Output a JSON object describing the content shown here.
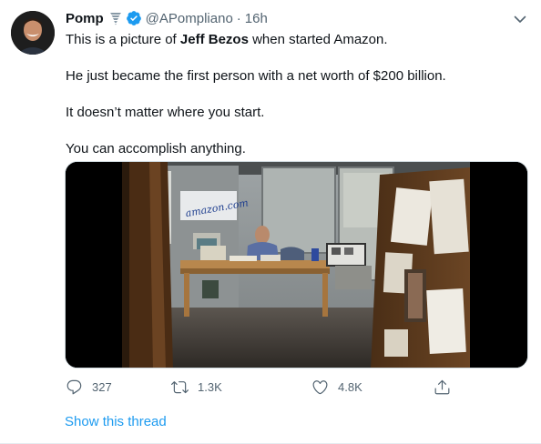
{
  "author": {
    "name": "Pomp",
    "handle": "@APompliano",
    "separator": "·",
    "time": "16h"
  },
  "tweet": {
    "line1_prefix": "This is a picture of ",
    "line1_bold": "Jeff Bezos",
    "line1_suffix": " when started Amazon.",
    "paragraph2": "He just became the first person with a net worth of $200 billion.",
    "paragraph3": "It doesn’t matter where you start.",
    "paragraph4": "You can accomplish anything."
  },
  "media": {
    "sign_text": "amazon.com"
  },
  "actions": {
    "reply_count": "327",
    "retweet_count": "1.3K",
    "like_count": "4.8K"
  },
  "thread_link": "Show this thread",
  "colors": {
    "accent": "#1d9bf0",
    "muted": "#536471",
    "text": "#0f1419"
  },
  "icons": [
    "tornado-icon",
    "verified-badge-icon",
    "chevron-down-icon",
    "reply-icon",
    "retweet-icon",
    "like-icon",
    "share-icon"
  ]
}
